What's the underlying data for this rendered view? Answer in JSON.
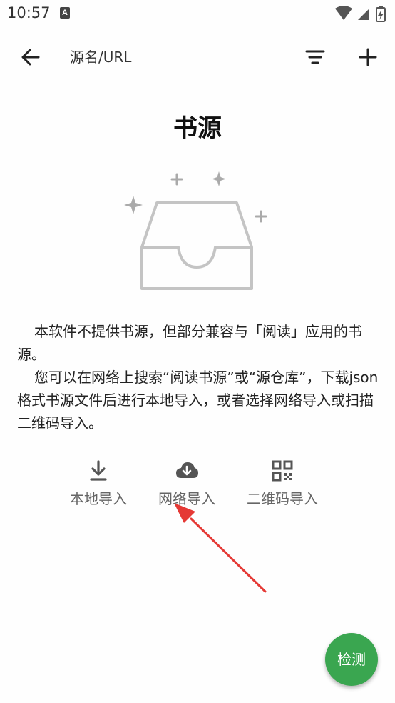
{
  "status_bar": {
    "time": "10:57",
    "notification_glyph": "A",
    "icons": [
      "wifi-icon",
      "signal-icon",
      "battery-icon"
    ]
  },
  "toolbar": {
    "search_hint": "源名/URL",
    "icons": [
      "back-arrow-icon",
      "filter-icon",
      "add-icon"
    ]
  },
  "main": {
    "title": "书源",
    "paragraph_1": "本软件不提供书源，但部分兼容与「阅读」应用的书源。",
    "paragraph_2": "您可以在网络上搜索“阅读书源”或“源仓库”，下载json格式书源文件后进行本地导入，或者选择网络导入或扫描二维码导入。"
  },
  "actions": [
    {
      "label": "本地导入",
      "icon": "download-icon"
    },
    {
      "label": "网络导入",
      "icon": "cloud-download-icon"
    },
    {
      "label": "二维码导入",
      "icon": "qr-code-icon"
    }
  ],
  "fab": {
    "label": "检测"
  },
  "colors": {
    "fab": "#3aa650",
    "annotation_arrow": "#e53935",
    "muted_text": "#666666"
  }
}
